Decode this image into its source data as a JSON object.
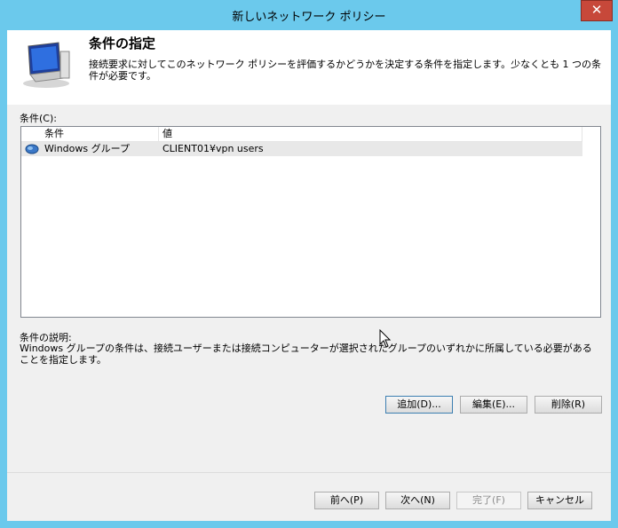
{
  "window": {
    "title": "新しいネットワーク ポリシー",
    "close_glyph": "✕"
  },
  "header": {
    "title": "条件の指定",
    "description": "接続要求に対してこのネットワーク ポリシーを評価するかどうかを決定する条件を指定します。少なくとも 1 つの条件が必要です。",
    "icon": "network-policy-monitor-icon"
  },
  "conditions": {
    "label": "条件(C):",
    "columns": [
      "条件",
      "値"
    ],
    "rows": [
      {
        "condition": "Windows グループ",
        "value": "CLIENT01¥vpn users",
        "icon": "group-icon"
      }
    ]
  },
  "description": {
    "label": "条件の説明:",
    "text": "Windows グループの条件は、接続ユーザーまたは接続コンピューターが選択されたグループのいずれかに所属している必要があることを指定します。"
  },
  "actions": {
    "add": "追加(D)...",
    "edit": "編集(E)...",
    "remove": "削除(R)"
  },
  "footer": {
    "back": "前へ(P)",
    "next": "次へ(N)",
    "finish": "完了(F)",
    "cancel": "キャンセル"
  }
}
